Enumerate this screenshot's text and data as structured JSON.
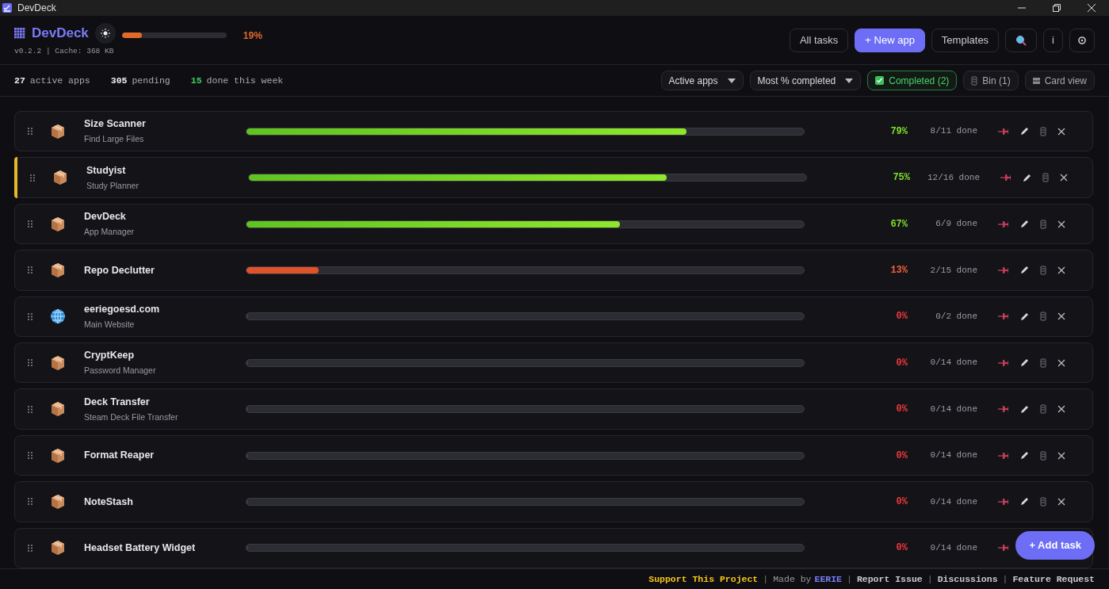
{
  "window": {
    "title": "DevDeck"
  },
  "header": {
    "title": "DevDeck",
    "meta": "v0.2.2 | Cache: 368 KB",
    "progress": {
      "level": 0.19,
      "reading": "19%"
    },
    "buttons": [
      {
        "label": "All tasks",
        "kind": "plain"
      },
      {
        "label": "+ New app",
        "kind": "primary"
      },
      {
        "label": "Templates",
        "kind": "plain"
      },
      {
        "kind": "search"
      },
      {
        "label": "i",
        "kind": "plain"
      },
      {
        "kind": "settings"
      }
    ]
  },
  "stats": [
    {
      "value": "27",
      "label": "active apps",
      "kind": "plain"
    },
    {
      "value": "305",
      "label": "pending",
      "kind": "plain"
    },
    {
      "value": "15",
      "label": "done this week",
      "kind": "good"
    }
  ],
  "filters": [
    {
      "label": "Active apps",
      "kind": "dropdown"
    },
    {
      "label": "Most % completed",
      "kind": "dropdown"
    },
    {
      "label": "Completed (2)",
      "kind": "toggle",
      "checked": true
    },
    {
      "label": "Bin (1)",
      "kind": "bin"
    },
    {
      "label": "Card view",
      "kind": "view"
    }
  ],
  "apps": [
    {
      "name": "Size Scanner",
      "subtitle": "Find Large Files",
      "kind": "box",
      "highlighted": false,
      "level": 0.79,
      "percent": "79%",
      "done": "8/11 done"
    },
    {
      "name": "Studyist",
      "subtitle": "Study Planner",
      "kind": "box",
      "highlighted": true,
      "level": 0.75,
      "percent": "75%",
      "done": "12/16 done"
    },
    {
      "name": "DevDeck",
      "subtitle": "App Manager",
      "kind": "box",
      "highlighted": false,
      "level": 0.67,
      "percent": "67%",
      "done": "6/9 done"
    },
    {
      "name": "Repo Declutter",
      "kind": "box",
      "highlighted": false,
      "level": 0.13,
      "percent": "13%",
      "done": "2/15 done"
    },
    {
      "name": "eeriegoesd.com",
      "subtitle": "Main Website",
      "kind": "globe",
      "highlighted": false,
      "level": 0,
      "percent": "0%",
      "done": "0/2 done"
    },
    {
      "name": "CryptKeep",
      "subtitle": "Password Manager",
      "kind": "box",
      "highlighted": false,
      "level": 0,
      "percent": "0%",
      "done": "0/14 done"
    },
    {
      "name": "Deck Transfer",
      "subtitle": "Steam Deck File Transfer",
      "kind": "box",
      "highlighted": false,
      "level": 0,
      "percent": "0%",
      "done": "0/14 done"
    },
    {
      "name": "Format Reaper",
      "kind": "box",
      "highlighted": false,
      "level": 0,
      "percent": "0%",
      "done": "0/14 done"
    },
    {
      "name": "NoteStash",
      "kind": "box",
      "highlighted": false,
      "level": 0,
      "percent": "0%",
      "done": "0/14 done"
    },
    {
      "name": "Headset Battery Widget",
      "kind": "box",
      "highlighted": false,
      "level": 0,
      "percent": "0%",
      "done": "0/14 done"
    }
  ],
  "add_button": {
    "label": "+ Add task"
  },
  "footer": [
    {
      "text": "Support This Project",
      "kind": "support"
    },
    {
      "text": "|",
      "kind": "sep"
    },
    {
      "text": "Made by",
      "kind": "muted"
    },
    {
      "text": "EERIE",
      "kind": "author"
    },
    {
      "text": "|",
      "kind": "sep"
    },
    {
      "text": "Report Issue",
      "kind": "link"
    },
    {
      "text": "|",
      "kind": "sep"
    },
    {
      "text": "Discussions",
      "kind": "link"
    },
    {
      "text": "|",
      "kind": "sep"
    },
    {
      "text": "Feature Request",
      "kind": "link"
    }
  ]
}
